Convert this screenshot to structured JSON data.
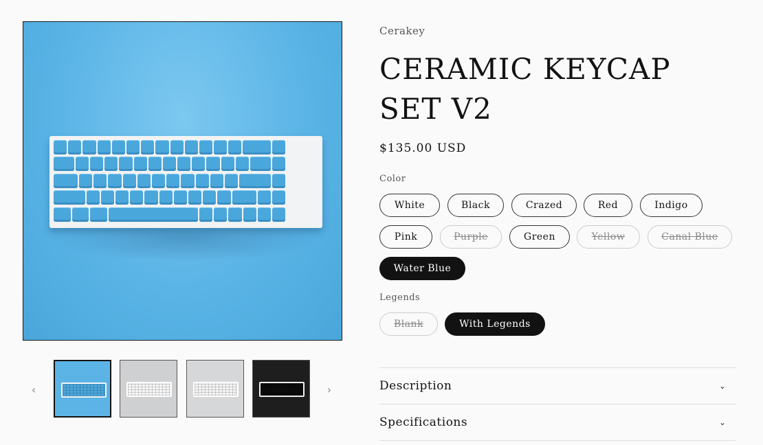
{
  "gallery": {
    "thumbnails": [
      {
        "name": "blue",
        "bg": "#5cb4e6",
        "kb": "#4aa7dc",
        "case": "#f1f3f4"
      },
      {
        "name": "white",
        "bg": "#cfd0d2",
        "kb": "#f5f5f5",
        "case": "#ffffff"
      },
      {
        "name": "white-2",
        "bg": "#d6d7d9",
        "kb": "#f3f3f3",
        "case": "#ffffff"
      },
      {
        "name": "black",
        "bg": "#1e1e1e",
        "kb": "#0b0b0b",
        "case": "#f0f0f0"
      }
    ],
    "prev_icon": "‹",
    "next_icon": "›"
  },
  "product": {
    "vendor": "Cerakey",
    "title": "CERAMIC KEYCAP SET V2",
    "price": "$135.00 USD"
  },
  "options": {
    "color_label": "Color",
    "colors": [
      {
        "label": "White",
        "state": "available"
      },
      {
        "label": "Black",
        "state": "available"
      },
      {
        "label": "Crazed",
        "state": "available"
      },
      {
        "label": "Red",
        "state": "available"
      },
      {
        "label": "Indigo",
        "state": "available"
      },
      {
        "label": "Pink",
        "state": "available"
      },
      {
        "label": "Purple",
        "state": "sold-out"
      },
      {
        "label": "Green",
        "state": "available"
      },
      {
        "label": "Yellow",
        "state": "sold-out"
      },
      {
        "label": "Canal Blue",
        "state": "sold-out"
      },
      {
        "label": "Water Blue",
        "state": "selected"
      }
    ],
    "legends_label": "Legends",
    "legends": [
      {
        "label": "Blank",
        "state": "sold-out"
      },
      {
        "label": "With Legends",
        "state": "selected"
      }
    ]
  },
  "accordion": [
    {
      "label": "Description",
      "icon": "chevron-down-icon"
    },
    {
      "label": "Specifications",
      "icon": "chevron-down-icon"
    }
  ],
  "colors": {
    "selected_bg": "#121212",
    "image_bg": "#5ab4e6",
    "keycap": "#4aa7dc"
  }
}
